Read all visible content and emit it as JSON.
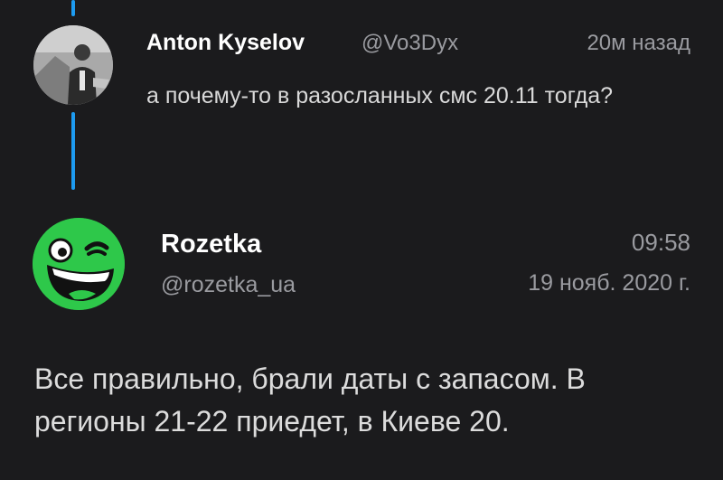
{
  "reply": {
    "author_name": "Anton Kyselov",
    "author_handle": "@Vo3Dyx",
    "time": "20м назад",
    "text": "а почему-то в разосланных смс 20.11 тогда?"
  },
  "main_post": {
    "author_name": "Rozetka",
    "author_handle": "@rozetka_ua",
    "time": "09:58",
    "date": "19 нояб. 2020 г.",
    "text": "Все правильно, брали даты с запасом. В регионы 21-22 приедет, в Киеве 20."
  },
  "colors": {
    "background": "#1b1b1d",
    "thread_line": "#1d9bf0",
    "rozetka_green": "#2ec84a"
  },
  "icons": {
    "reply_avatar": "user-photo-avatar",
    "main_avatar": "rozetka-smiley-logo"
  }
}
